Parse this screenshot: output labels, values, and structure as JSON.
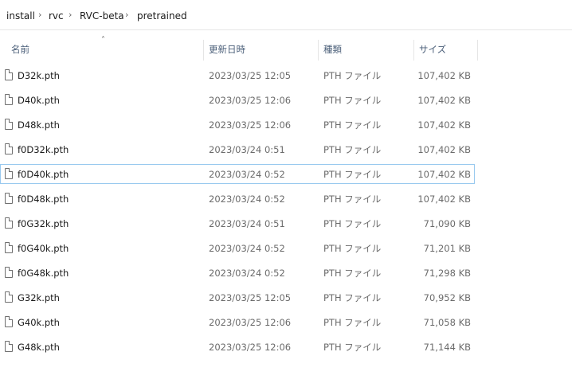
{
  "breadcrumb": [
    {
      "label": "install"
    },
    {
      "label": "rvc"
    },
    {
      "label": "RVC-beta"
    },
    {
      "label": "pretrained"
    }
  ],
  "columns": {
    "name": "名前",
    "date": "更新日時",
    "type": "種類",
    "size": "サイズ"
  },
  "files": [
    {
      "name": "D32k.pth",
      "date": "2023/03/25 12:05",
      "type": "PTH ファイル",
      "size": "107,402 KB"
    },
    {
      "name": "D40k.pth",
      "date": "2023/03/25 12:06",
      "type": "PTH ファイル",
      "size": "107,402 KB"
    },
    {
      "name": "D48k.pth",
      "date": "2023/03/25 12:06",
      "type": "PTH ファイル",
      "size": "107,402 KB"
    },
    {
      "name": "f0D32k.pth",
      "date": "2023/03/24 0:51",
      "type": "PTH ファイル",
      "size": "107,402 KB"
    },
    {
      "name": "f0D40k.pth",
      "date": "2023/03/24 0:52",
      "type": "PTH ファイル",
      "size": "107,402 KB",
      "focused": true
    },
    {
      "name": "f0D48k.pth",
      "date": "2023/03/24 0:52",
      "type": "PTH ファイル",
      "size": "107,402 KB"
    },
    {
      "name": "f0G32k.pth",
      "date": "2023/03/24 0:51",
      "type": "PTH ファイル",
      "size": "71,090 KB"
    },
    {
      "name": "f0G40k.pth",
      "date": "2023/03/24 0:52",
      "type": "PTH ファイル",
      "size": "71,201 KB"
    },
    {
      "name": "f0G48k.pth",
      "date": "2023/03/24 0:52",
      "type": "PTH ファイル",
      "size": "71,298 KB"
    },
    {
      "name": "G32k.pth",
      "date": "2023/03/25 12:05",
      "type": "PTH ファイル",
      "size": "70,952 KB"
    },
    {
      "name": "G40k.pth",
      "date": "2023/03/25 12:06",
      "type": "PTH ファイル",
      "size": "71,058 KB"
    },
    {
      "name": "G48k.pth",
      "date": "2023/03/25 12:06",
      "type": "PTH ファイル",
      "size": "71,144 KB"
    }
  ],
  "icons": {
    "sort": "chevron-up-icon",
    "separator": "chevron-right-icon",
    "file": "file-icon"
  },
  "colors": {
    "focus_border": "#99c9ef",
    "header_text": "#4c607a"
  }
}
